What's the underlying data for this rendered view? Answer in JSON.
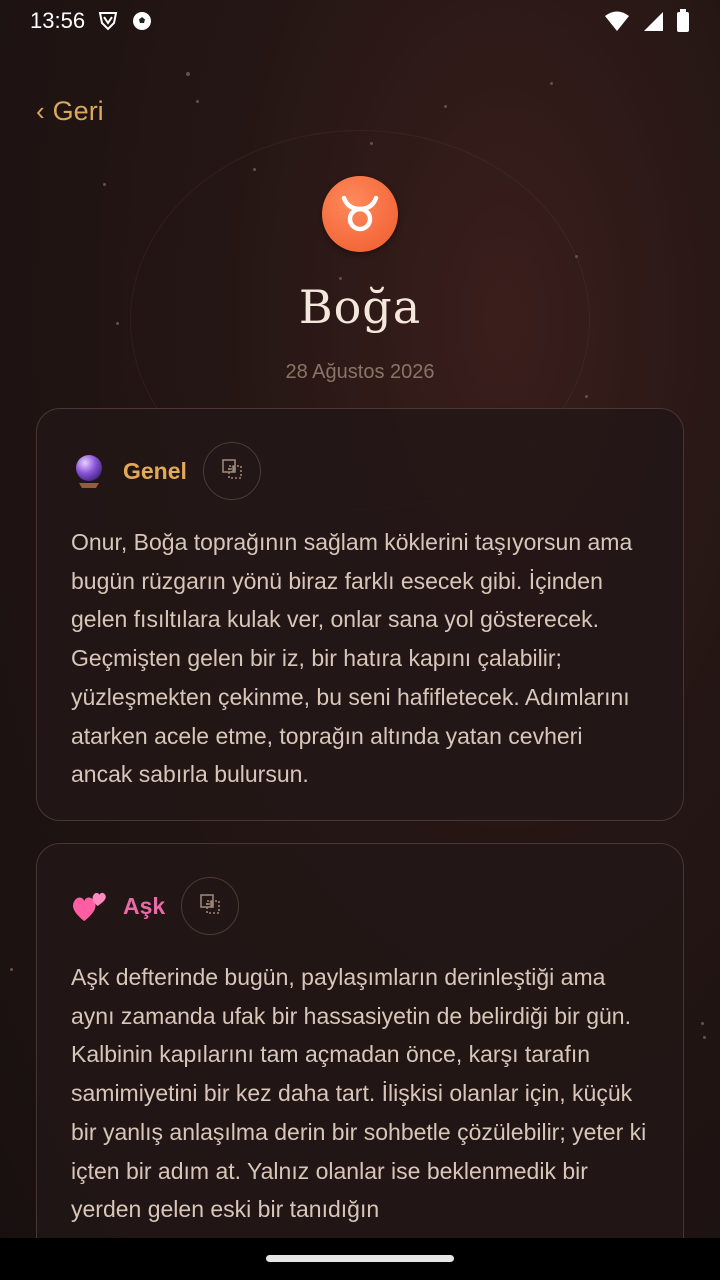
{
  "status_bar": {
    "time": "13:56",
    "icons": [
      "vpn-shield-icon",
      "soccer-ball-icon",
      "wifi-icon",
      "signal-icon",
      "battery-icon"
    ]
  },
  "nav": {
    "back_label": "Geri"
  },
  "sign": {
    "symbol": "♉",
    "name": "Boğa",
    "date": "28 Ağustos 2026",
    "badge_color": "#ef5a2c"
  },
  "sections": [
    {
      "title": "Genel",
      "icon": "crystal-ball-icon",
      "title_color": "#e3a85a",
      "text": "Onur, Boğa toprağının sağlam köklerini taşıyorsun ama bugün rüzgarın yönü biraz farklı esecek gibi. İçinden gelen fısıltılara kulak ver, onlar sana yol gösterecek. Geçmişten gelen bir iz, bir hatıra kapını çalabilir; yüzleşmekten çekinme, bu seni hafifletecek. Adımlarını atarken acele etme, toprağın altında yatan cevheri ancak sabırla bulursun."
    },
    {
      "title": "Aşk",
      "icon": "two-hearts-icon",
      "title_color": "#e86aa6",
      "text": "Aşk defterinde bugün, paylaşımların derinleştiği ama aynı zamanda ufak bir hassasiyetin de belirdiği bir gün. Kalbinin kapılarını tam açmadan önce, karşı tarafın samimiyetini bir kez daha tart. İlişkisi olanlar için, küçük bir yanlış anlaşılma derin bir sohbetle çözülebilir; yeter ki içten bir adım at. Yalnız olanlar ise beklenmedik bir yerden gelen eski bir tanıdığın"
    }
  ],
  "colors": {
    "accent": "#d9a85b",
    "background": "#1f1413",
    "card_border": "#4a3630"
  }
}
